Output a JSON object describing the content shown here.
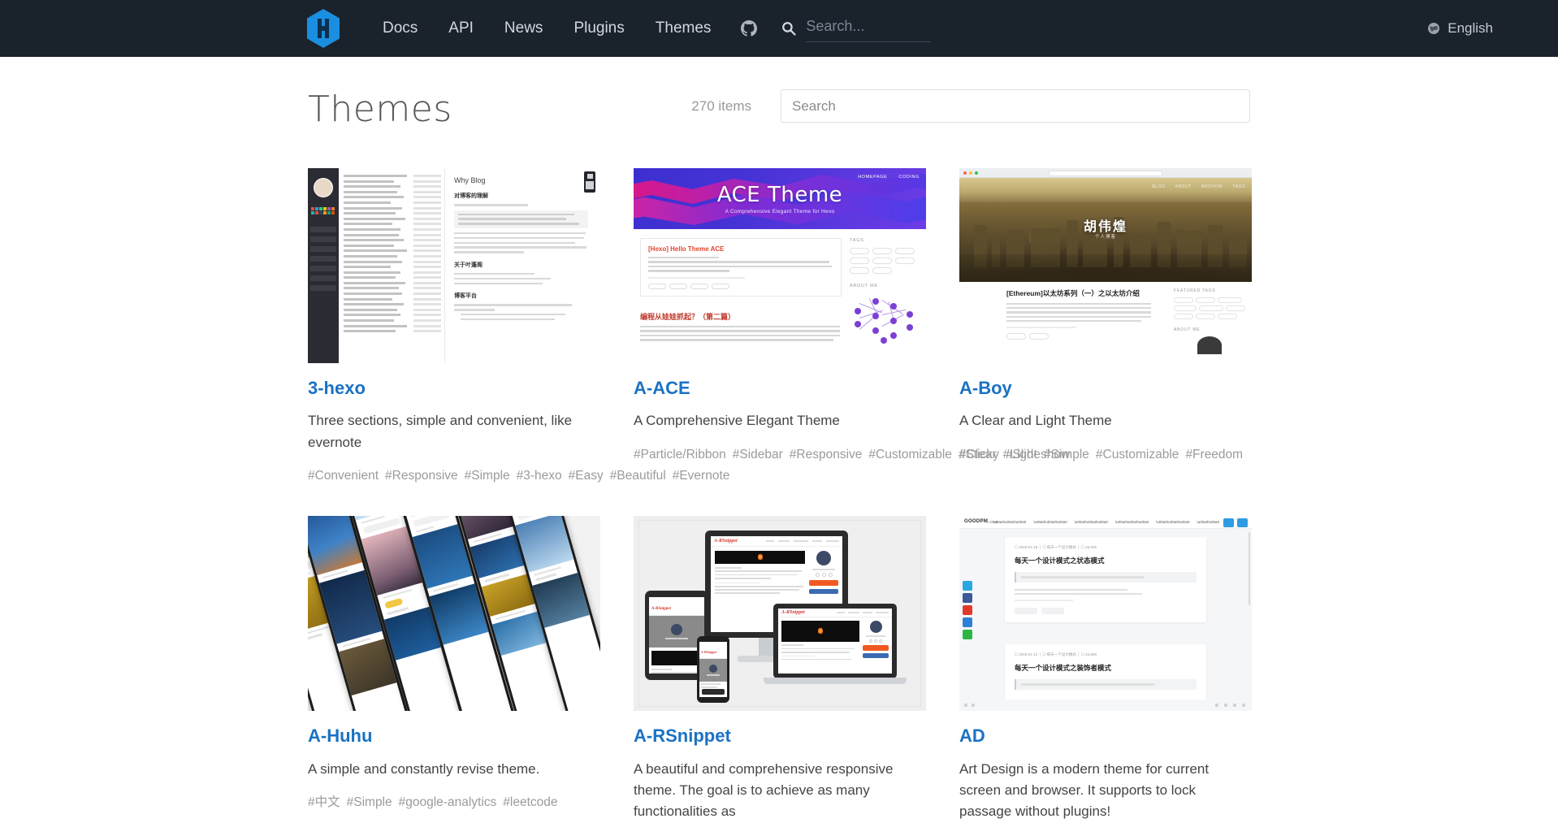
{
  "navbar": {
    "logo_alt": "Hexo",
    "links": [
      {
        "label": "Docs"
      },
      {
        "label": "API"
      },
      {
        "label": "News"
      },
      {
        "label": "Plugins"
      },
      {
        "label": "Themes"
      }
    ],
    "github_icon": "github-icon",
    "search_icon": "search-icon",
    "search_placeholder": "Search...",
    "search_value": "",
    "language": "English",
    "globe_icon": "globe-icon",
    "background": "#1a222c"
  },
  "page": {
    "title": "Themes",
    "item_count": "270 items",
    "search_placeholder": "Search",
    "search_value": "",
    "accent": "#1a72c4"
  },
  "themes": [
    {
      "name": "3-hexo",
      "description": "Three sections, simple and convenient, like evernote",
      "tags": [
        "#Convenient",
        "#Responsive",
        "#Simple",
        "#3-hexo",
        "#Easy",
        "#Beautiful",
        "#Evernote"
      ],
      "preview": {
        "kind": "3hexo",
        "heading": "Why Blog",
        "sub_heading_1": "对博客的理解",
        "sub_heading_2": "关于叶蓬阁",
        "sub_heading_3": "博客平台"
      }
    },
    {
      "name": "A-ACE",
      "description": "A Comprehensive Elegant Theme",
      "tags": [
        "#Particle/Ribbon",
        "#Sidebar",
        "#Responsive",
        "#Customizable",
        "#Sticky",
        "#Slideshow"
      ],
      "preview": {
        "kind": "ace",
        "hero_title": "ACE Theme",
        "hero_subtitle": "A Comprehensive Elegant Theme for Hexo",
        "hero_nav": [
          "HOMEPAGE",
          "CODING"
        ],
        "post_title": "[Hexo] Hello Theme ACE",
        "post2_title": "编程从娃娃抓起？（第二篇）",
        "aside_labels": [
          "TAGS",
          "ABOUT ME"
        ]
      }
    },
    {
      "name": "A-Boy",
      "description": "A Clear and Light Theme",
      "tags": [
        "#Clear",
        "#Light",
        "#Simple",
        "#Customizable",
        "#Freedom"
      ],
      "preview": {
        "kind": "aboy",
        "hero_name": "胡伟煌",
        "hero_sub": "个人博客",
        "topnav": [
          "BLOG",
          "ABOUT",
          "ARCHIVE",
          "TAGS"
        ],
        "post_title": "[Ethereum]以太坊系列（一）之以太坊介绍",
        "aside_labels": [
          "FEATURED TAGS",
          "ABOUT ME"
        ]
      }
    },
    {
      "name": "A-Huhu",
      "description": "A simple and constantly revise theme.",
      "tags": [
        "#中文",
        "#Simple",
        "#google-analytics",
        "#leetcode"
      ],
      "preview": {
        "kind": "huhu"
      }
    },
    {
      "name": "A-RSnippet",
      "description": "A beautiful and comprehensive responsive theme. The goal is to achieve as many functionalities as",
      "tags": [],
      "preview": {
        "kind": "rsnippet",
        "brand": "A-RSnippet"
      }
    },
    {
      "name": "AD",
      "description": "Art Design is a modern theme for current screen and browser. It supports to lock passage without plugins!",
      "tags": [],
      "preview": {
        "kind": "ad",
        "logo": "GOODPM",
        "post1": "每天一个设计模式之状态模式",
        "post2": "每天一个设计模式之装饰者模式"
      }
    }
  ]
}
